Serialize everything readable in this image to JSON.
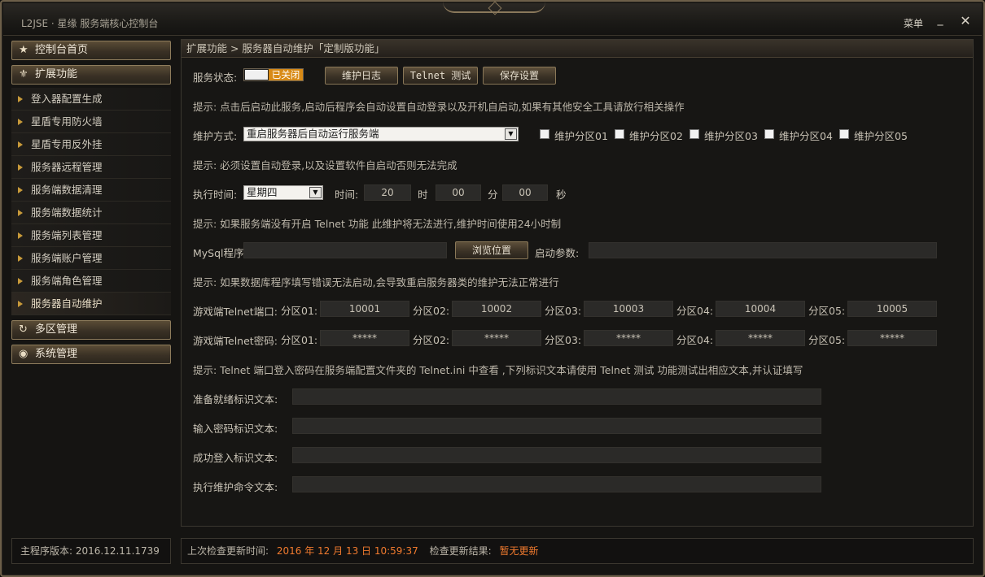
{
  "window": {
    "title": "L2JSE · 星缘 服务端核心控制台",
    "menu_label": "菜单",
    "minimize_label": "_",
    "close_label": "✕"
  },
  "sidebar": {
    "home_label": "控制台首页",
    "ext_label": "扩展功能",
    "items": [
      {
        "label": "登入器配置生成"
      },
      {
        "label": "星盾专用防火墙"
      },
      {
        "label": "星盾专用反外挂"
      },
      {
        "label": "服务器远程管理"
      },
      {
        "label": "服务端数据清理"
      },
      {
        "label": "服务端数据统计"
      },
      {
        "label": "服务端列表管理"
      },
      {
        "label": "服务端账户管理"
      },
      {
        "label": "服务端角色管理"
      },
      {
        "label": "服务器自动维护"
      }
    ],
    "active_item": "服务器自动维护",
    "multi_zone_label": "多区管理",
    "system_label": "系统管理"
  },
  "version": "主程序版本: 2016.12.11.1739",
  "main": {
    "breadcrumb": "扩展功能 > 服务器自动维护「定制版功能」",
    "service_status_label": "服务状态:",
    "service_status_value": "已关闭",
    "buttons": {
      "log": "维护日志",
      "telnet_test": "Telnet 测试",
      "save": "保存设置",
      "browse": "浏览位置"
    },
    "hint1": "提示: 点击后启动此服务,启动后程序会自动设置自动登录以及开机自启动,如果有其他安全工具请放行相关操作",
    "mode_label": "维护方式:",
    "mode_value": "重启服务器后自动运行服务端",
    "zones": [
      {
        "label": "维护分区01",
        "checked": false
      },
      {
        "label": "维护分区02",
        "checked": false
      },
      {
        "label": "维护分区03",
        "checked": false
      },
      {
        "label": "维护分区04",
        "checked": false
      },
      {
        "label": "维护分区05",
        "checked": false
      }
    ],
    "hint2": "提示: 必须设置自动登录,以及设置软件自启动否则无法完成",
    "exec_time_label": "执行时间:",
    "weekday_value": "星期四",
    "time_label": "时间:",
    "hour": "20",
    "hour_unit": "时",
    "minute": "00",
    "minute_unit": "分",
    "second": "00",
    "second_unit": "秒",
    "hint3": "提示: 如果服务端没有开启 Telnet 功能 此维护将无法进行,维护时间使用24小时制",
    "mysql_label": "MySql程序:",
    "mysql_value": "",
    "start_args_label": "启动参数:",
    "start_args_value": "",
    "hint4": "提示: 如果数据库程序填写错误无法启动,会导致重启服务器类的维护无法正常进行",
    "telnet_port_label": "游戏端Telnet端口:",
    "telnet_ports": [
      {
        "label": "分区01:",
        "value": "10001"
      },
      {
        "label": "分区02:",
        "value": "10002"
      },
      {
        "label": "分区03:",
        "value": "10003"
      },
      {
        "label": "分区04:",
        "value": "10004"
      },
      {
        "label": "分区05:",
        "value": "10005"
      }
    ],
    "telnet_pwd_label": "游戏端Telnet密码:",
    "telnet_pwds": [
      {
        "label": "分区01:",
        "value": "*****"
      },
      {
        "label": "分区02:",
        "value": "*****"
      },
      {
        "label": "分区03:",
        "value": "*****"
      },
      {
        "label": "分区04:",
        "value": "*****"
      },
      {
        "label": "分区05:",
        "value": "*****"
      }
    ],
    "hint5": "提示: Telnet 端口登入密码在服务端配置文件夹的 Telnet.ini 中查看 ,下列标识文本请使用 Telnet 测试 功能测试出相应文本,并认证填写",
    "ready_label": "准备就绪标识文本:",
    "ready_value": "",
    "pwd_prompt_label": "输入密码标识文本:",
    "pwd_prompt_value": "",
    "login_ok_label": "成功登入标识文本:",
    "login_ok_value": "",
    "cmd_label": "执行维护命令文本:",
    "cmd_value": ""
  },
  "status": {
    "last_check_label": "上次检查更新时间:",
    "last_check_value": "2016 年 12 月 13 日 10:59:37",
    "result_label": "检查更新结果:",
    "result_value": "暂无更新"
  },
  "colors": {
    "accent": "#f07a2e",
    "toggle_off": "#d88a16",
    "frame_gold": "#8a7858"
  },
  "icons": {
    "home": "star-icon",
    "ext": "fleur-icon",
    "multi_zone": "refresh-icon",
    "system": "eye-icon",
    "sub_items": "triangle-right-icon"
  }
}
